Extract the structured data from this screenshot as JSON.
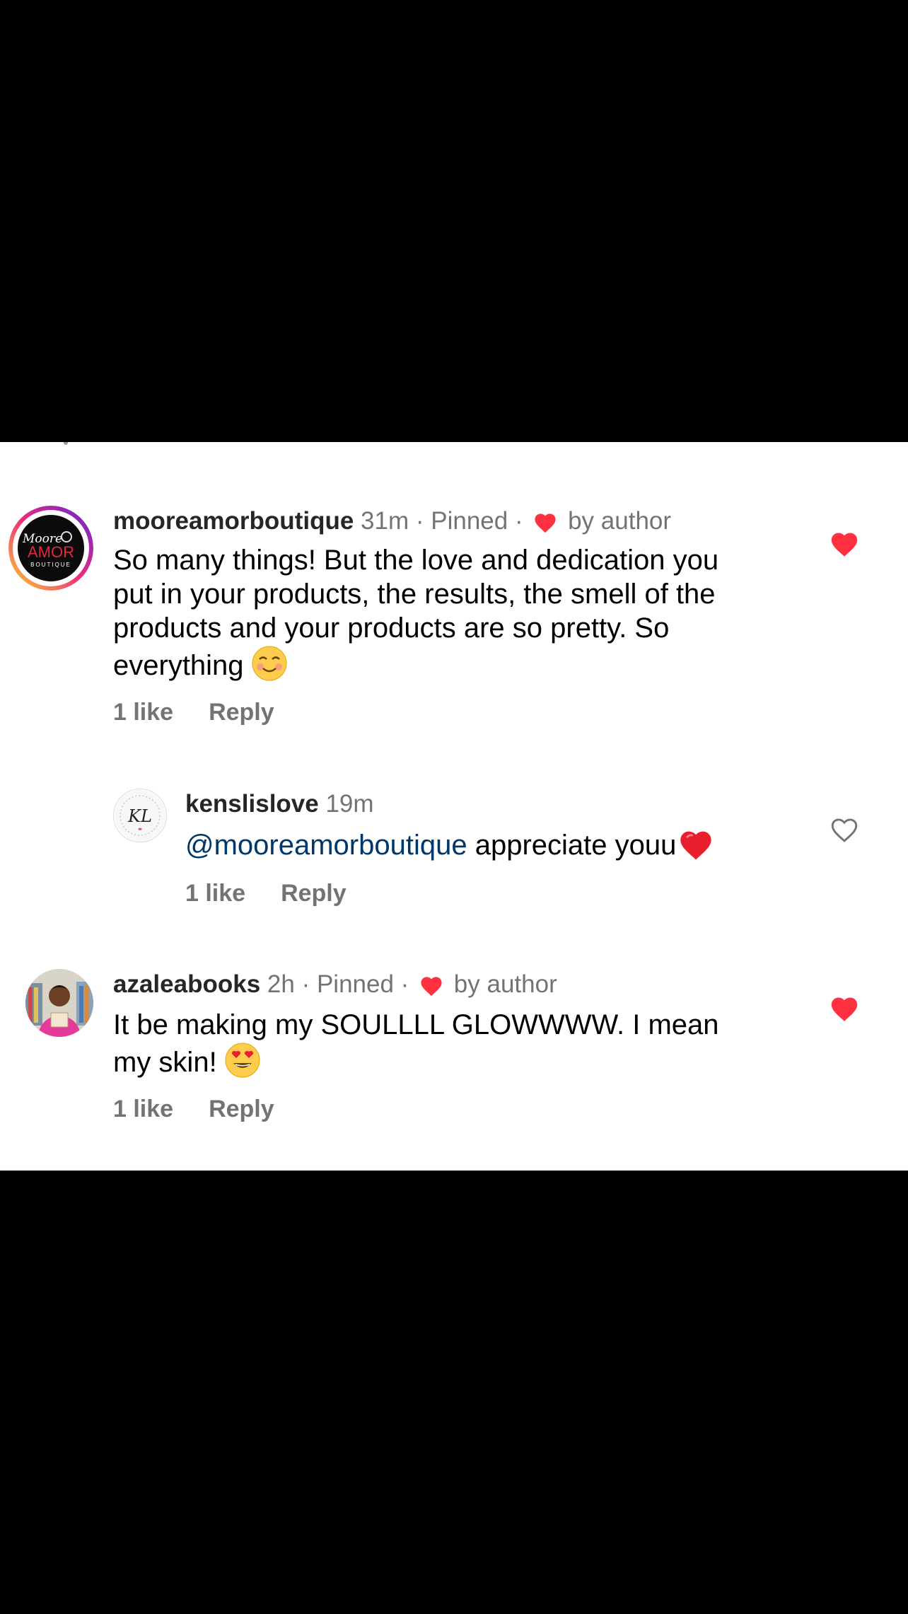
{
  "colors": {
    "heart_red": "#ff3040",
    "mention_blue": "#00376b",
    "meta_gray": "#737373",
    "story_ring": [
      "#f9ce34",
      "#ee2a7b",
      "#6228d7"
    ]
  },
  "comments": [
    {
      "username": "mooreamorboutique",
      "time": "31m",
      "separator": "·",
      "pinned": "Pinned",
      "by_author": "by author",
      "text": "So many things! But the love and dedication you\nput in your products, the results, the smell of the\nproducts and your products are so pretty. So\neverything",
      "emoji": "smiling-face-emoji",
      "likes": "1 like",
      "reply": "Reply",
      "liked": true,
      "avatar_logo": {
        "top": "Moore",
        "middle": "AMOR",
        "bottom": "BOUTIQUE"
      }
    },
    {
      "username": "kenslislove",
      "time": "19m",
      "mention": "@mooreamorboutique",
      "text": " appreciate youu",
      "likes": "1 like",
      "reply": "Reply",
      "liked": false,
      "avatar_logo": {
        "initials": "KL"
      }
    },
    {
      "username": "azaleabooks",
      "time": "2h",
      "separator": "·",
      "pinned": "Pinned",
      "by_author": "by author",
      "text": "It be making my SOULLLL GLOWWWW. I mean\nmy skin!",
      "emoji": "heart-eyes-emoji",
      "likes": "1 like",
      "reply": "Reply",
      "liked": true
    }
  ]
}
